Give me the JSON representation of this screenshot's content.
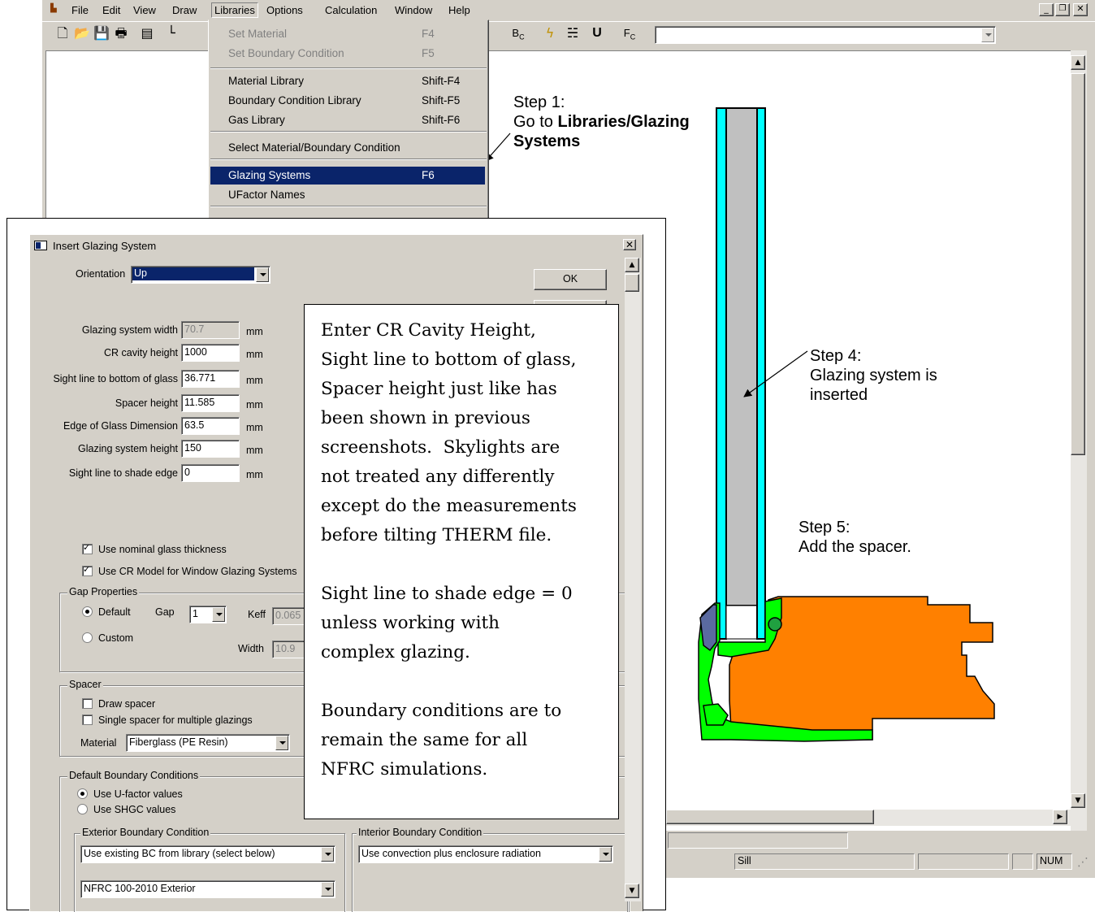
{
  "app": {
    "menus": [
      "File",
      "Edit",
      "View",
      "Draw",
      "Libraries",
      "Options",
      "Calculation",
      "Window",
      "Help"
    ],
    "toolbar_icons": [
      "new-file-icon",
      "open-folder-icon",
      "save-icon",
      "print-icon",
      "properties-icon",
      "draw-tool-icon",
      "boundary-condition-icon",
      "calculate-icon",
      "mesh-icon",
      "ufactor-icon",
      "result-icon"
    ],
    "toolbar_labels": {
      "bc": "B",
      "bc_sub": "C",
      "u": "U",
      "fc": "F",
      "fc_sub": "C"
    },
    "status": {
      "sill": "Sill",
      "num": "NUM"
    }
  },
  "libraries_menu": {
    "items": [
      {
        "label": "Set Material",
        "shortcut": "F4",
        "state": "disabled"
      },
      {
        "label": "Set Boundary Condition",
        "shortcut": "F5",
        "state": "disabled"
      },
      {
        "label": "Material Library",
        "shortcut": "Shift-F4",
        "state": "normal"
      },
      {
        "label": "Boundary Condition Library",
        "shortcut": "Shift-F5",
        "state": "normal"
      },
      {
        "label": "Gas Library",
        "shortcut": "Shift-F6",
        "state": "normal"
      },
      {
        "label": "Select Material/Boundary Condition",
        "shortcut": "",
        "state": "normal"
      },
      {
        "label": "Glazing Systems",
        "shortcut": "F6",
        "state": "selected"
      },
      {
        "label": "UFactor Names",
        "shortcut": "",
        "state": "normal"
      }
    ]
  },
  "dialog": {
    "title": "Insert Glazing System",
    "ok_label": "OK",
    "orientation": {
      "label": "Orientation",
      "value": "Up"
    },
    "fields": [
      {
        "label": "Glazing system width",
        "value": "70.7",
        "unit": "mm",
        "disabled": true
      },
      {
        "label": "CR cavity height",
        "value": "1000",
        "unit": "mm",
        "disabled": false
      },
      {
        "label": "Sight line to bottom of glass",
        "value": "36.771",
        "unit": "mm",
        "disabled": false
      },
      {
        "label": "Spacer height",
        "value": "11.585",
        "unit": "mm",
        "disabled": false
      },
      {
        "label": "Edge of Glass Dimension",
        "value": "63.5",
        "unit": "mm",
        "disabled": false
      },
      {
        "label": "Glazing system height",
        "value": "150",
        "unit": "mm",
        "disabled": false
      },
      {
        "label": "Sight line to shade edge",
        "value": "0",
        "unit": "mm",
        "disabled": false
      }
    ],
    "use_nominal": "Use nominal glass thickness",
    "use_cr": "Use CR Model for Window Glazing Systems",
    "gap": {
      "title": "Gap Properties",
      "default": "Default",
      "custom": "Custom",
      "gap_label": "Gap",
      "gap_value": "1",
      "keff_label": "Keff",
      "keff_value": "0.065",
      "width_label": "Width",
      "width_value": "10.9"
    },
    "spacer": {
      "title": "Spacer",
      "draw": "Draw spacer",
      "single": "Single spacer for multiple glazings",
      "material_label": "Material",
      "material_value": "Fiberglass (PE Resin)"
    },
    "boundary": {
      "title": "Default Boundary Conditions",
      "ufactor": "Use U-factor values",
      "shgc": "Use SHGC values",
      "exterior_title": "Exterior Boundary Condition",
      "exterior_value": "Use existing BC from library (select below)",
      "exterior_lib": "NFRC 100-2010 Exterior",
      "interior_title": "Interior Boundary Condition",
      "interior_value": "Use convection plus enclosure radiation"
    }
  },
  "annotations": {
    "step1_line1": "Step 1:",
    "step1_line2_plain": "Go to ",
    "step1_line2_bold": "Libraries/Glazing",
    "step1_line3_bold": "Systems",
    "step4_line1": "Step 4:",
    "step4_line2": "Glazing system is",
    "step4_line3": "inserted",
    "step5_line1": "Step 5:",
    "step5_line2": "Add the spacer.",
    "note_p1": [
      "Enter CR Cavity Height,",
      "Sight line to bottom of glass,",
      "Spacer height just like has",
      "been shown in previous",
      "screenshots.  Skylights are",
      "not treated any differently",
      "except do the measurements",
      "before tilting THERM file."
    ],
    "note_p2": [
      "Sight line to shade edge = 0",
      "unless working with",
      "complex glazing."
    ],
    "note_p3": [
      "Boundary conditions are to",
      "remain the same for all",
      "NFRC simulations."
    ]
  },
  "colors": {
    "frame_orange": "#ff8000",
    "frame_green": "#00ff00",
    "glass_cyan": "#00ffff",
    "gas_gray": "#c0c0c0",
    "menu_highlight": "#0a246a"
  }
}
